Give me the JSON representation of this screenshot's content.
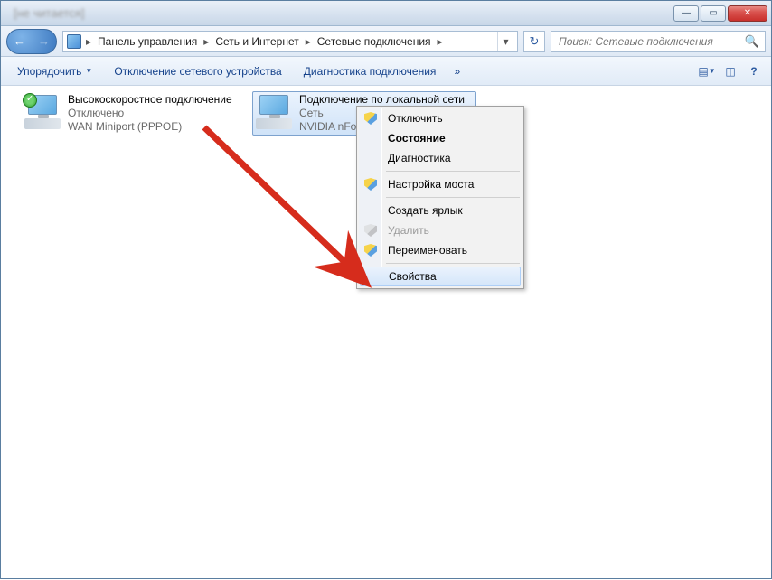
{
  "titlebar": {
    "window_blur_title": "[не читается]",
    "min_label": "—",
    "max_label": "▭",
    "close_label": "✕"
  },
  "breadcrumb": {
    "items": [
      "Панель управления",
      "Сеть и Интернет",
      "Сетевые подключения"
    ]
  },
  "search": {
    "placeholder": "Поиск: Сетевые подключения"
  },
  "cmdbar": {
    "organize": "Упорядочить",
    "disable_device": "Отключение сетевого устройства",
    "diagnose": "Диагностика подключения"
  },
  "connections": [
    {
      "title": "Высокоскоростное подключение",
      "line2": "Отключено",
      "line3": "WAN Miniport (PPPOE)"
    },
    {
      "title": "Подключение по локальной сети",
      "line2": "Сеть",
      "line3": "NVIDIA nFor"
    }
  ],
  "context_menu": {
    "disable": "Отключить",
    "status": "Состояние",
    "diagnose": "Диагностика",
    "bridge": "Настройка моста",
    "shortcut": "Создать ярлык",
    "delete": "Удалить",
    "rename": "Переименовать",
    "properties": "Свойства"
  }
}
